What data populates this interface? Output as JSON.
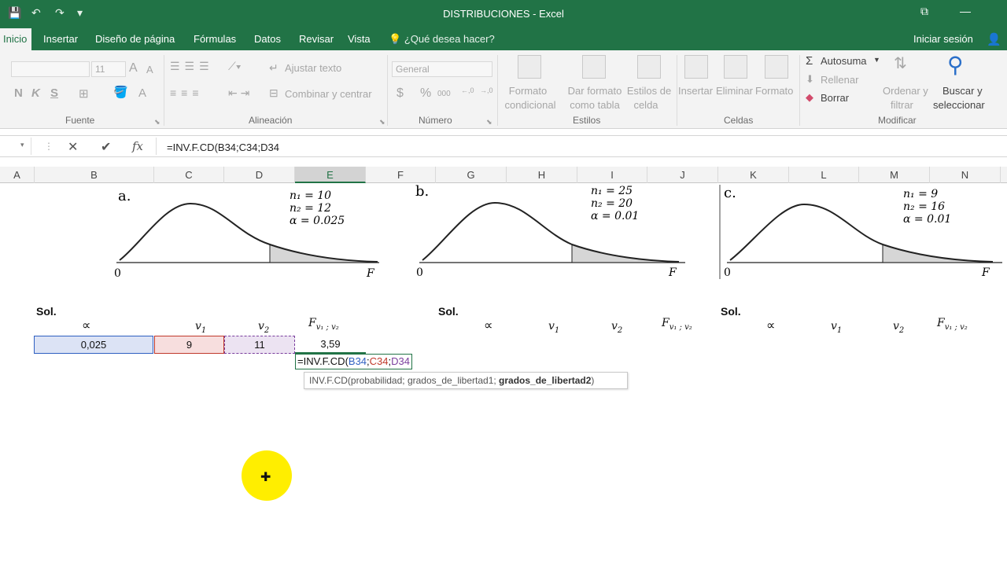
{
  "window": {
    "title": "DISTRIBUCIONES - Excel",
    "qat": {
      "save": "💾",
      "undo": "↶",
      "redo": "↷",
      "more": "▾"
    },
    "buttons": {
      "restore": "⧉",
      "minimize": "—"
    }
  },
  "tabs": [
    "Inicio",
    "Insertar",
    "Diseño de página",
    "Fórmulas",
    "Datos",
    "Revisar",
    "Vista"
  ],
  "tell_me": "¿Qué desea hacer?",
  "sign_in": "Iniciar sesión",
  "ribbon": {
    "font": {
      "label": "Fuente",
      "size": "11",
      "bold": "N",
      "italic": "K",
      "underline": "S",
      "grow": "A",
      "shrink": "A",
      "font_color": "A"
    },
    "alignment": {
      "label": "Alineación",
      "wrap": "Ajustar texto",
      "merge": "Combinar y centrar"
    },
    "number": {
      "label": "Número",
      "format": "General",
      "currency": "$",
      "percent": "%",
      "thousands": "000",
      "inc_decimal": ",00\n,0",
      "dec_decimal": ",0\n,00"
    },
    "styles": {
      "label": "Estilos",
      "conditional": [
        "Formato",
        "condicional"
      ],
      "as_table": [
        "Dar formato",
        "como tabla"
      ],
      "cell_styles": [
        "Estilos de",
        "celda"
      ]
    },
    "cells": {
      "label": "Celdas",
      "insert": "Insertar",
      "delete": "Eliminar",
      "format": "Formato"
    },
    "editing": {
      "label": "Modificar",
      "autosum": "Autosuma",
      "fill": "Rellenar",
      "clear": "Borrar",
      "sort": [
        "Ordenar y",
        "filtrar"
      ],
      "find": [
        "Buscar y",
        "seleccionar"
      ]
    }
  },
  "formula_bar": {
    "formula": "=INV.F.CD(B34;C34;D34",
    "cancel": "✕",
    "enter": "✔",
    "fx": "fx"
  },
  "columns": [
    "A",
    "B",
    "C",
    "D",
    "E",
    "F",
    "G",
    "H",
    "I",
    "J",
    "K",
    "L",
    "M",
    "N"
  ],
  "figures": [
    {
      "letter": "a.",
      "n1": "n₁ = 10",
      "n2": "n₂ = 12",
      "alpha": "α = 0.025",
      "origin": "0",
      "axis": "F"
    },
    {
      "letter": "b.",
      "n1": "n₁ = 25",
      "n2": "n₂ = 20",
      "alpha": "α = 0.01",
      "origin": "0",
      "axis": "F"
    },
    {
      "letter": "c.",
      "n1": "n₁ = 9",
      "n2": "n₂ = 16",
      "alpha": "α = 0.01",
      "origin": "0",
      "axis": "F"
    }
  ],
  "solution": {
    "sol": "Sol.",
    "alpha": "∝",
    "v1": "v",
    "v2": "v",
    "sub1": "1",
    "sub2": "2",
    "F": "F",
    "Fsub": "v₁ ; v₂",
    "row": {
      "alpha": "0,025",
      "v1": "9",
      "v2": "11",
      "result": "3,59"
    }
  },
  "edit_formula": {
    "prefix": "=INV.F.CD(",
    "ref1": "B34",
    "sep1": ";",
    "ref2": "C34",
    "sep2": ";",
    "ref3": "D34"
  },
  "tooltip": {
    "text": "INV.F.CD(probabilidad; grados_de_libertad1; ",
    "bold": "grados_de_libertad2",
    "close": ")"
  },
  "colors": {
    "excel_green": "#217346",
    "ref_blue": "#2e5fc1",
    "ref_red": "#c0392b",
    "ref_purple": "#7a3e9d",
    "pointer": "#ffee00"
  }
}
